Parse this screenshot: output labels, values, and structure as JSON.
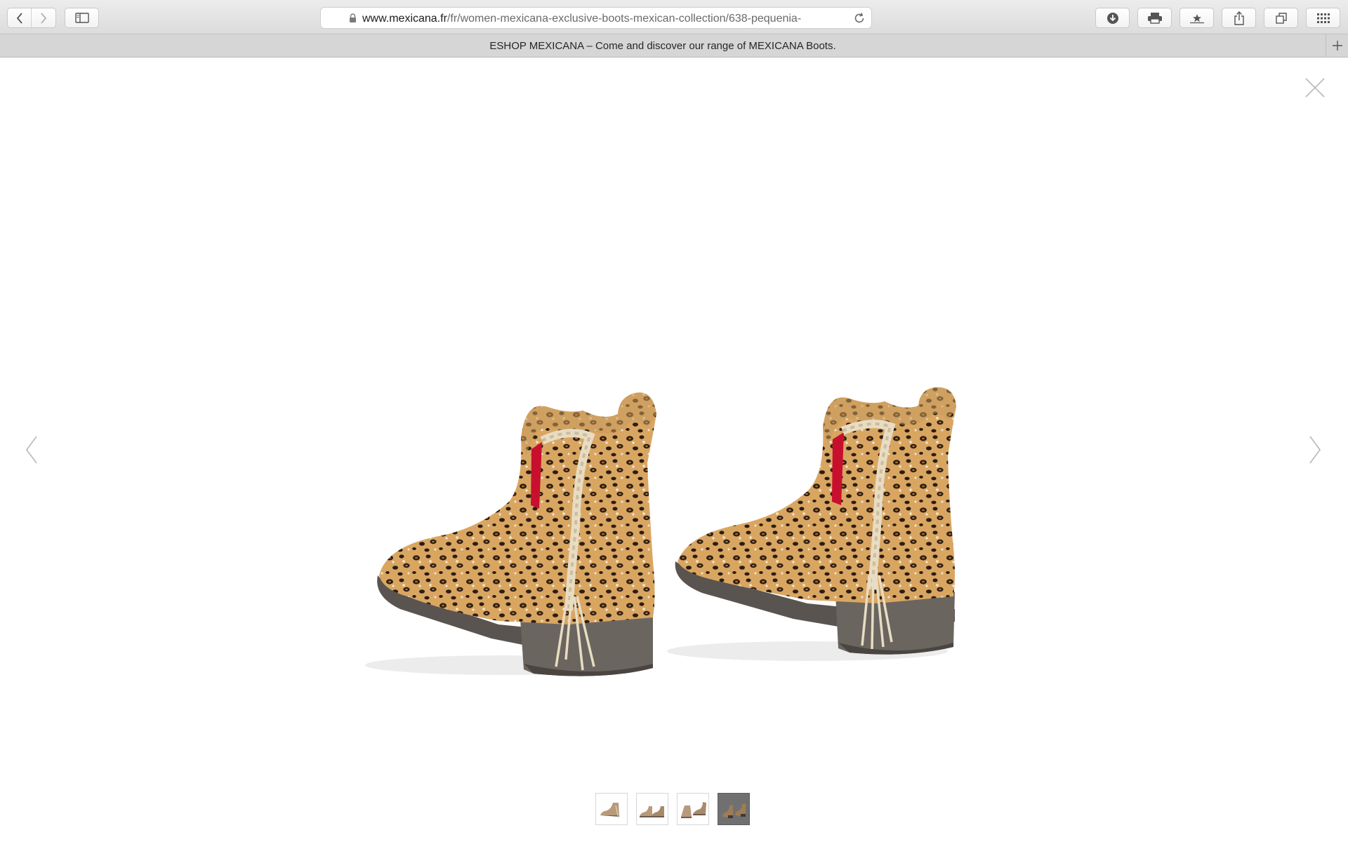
{
  "browser": {
    "url_host": "www.mexicana.fr",
    "url_path": "/fr/women-mexicana-exclusive-boots-mexican-collection/638-pequenia-",
    "tab_title": "ESHOP MEXICANA – Come and discover our range of MEXICANA Boots."
  },
  "lightbox": {
    "thumbnails": [
      {
        "state": "default"
      },
      {
        "state": "default"
      },
      {
        "state": "default"
      },
      {
        "state": "active"
      }
    ],
    "active_index": 3,
    "colors": {
      "leopard_base": "#d9a662",
      "leopard_spot": "#2b1d12",
      "sole": "#5a5450",
      "lining": "#c8102e",
      "fringe": "#e8dcc2"
    }
  },
  "icons": [
    "back-arrow-icon",
    "forward-arrow-icon",
    "sidebar-icon",
    "lock-icon",
    "reload-icon",
    "download-icon",
    "print-icon",
    "bookmark-star-icon",
    "share-icon",
    "tabs-overview-icon",
    "grid-icon",
    "plus-icon",
    "close-icon",
    "chevron-left-icon",
    "chevron-right-icon"
  ]
}
